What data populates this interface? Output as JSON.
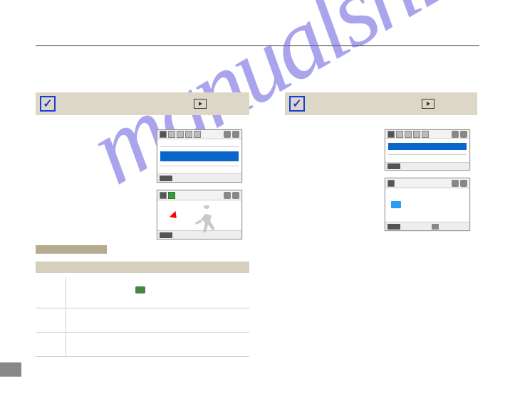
{
  "watermark": "manualshive.com",
  "left": {
    "check": "✓",
    "menu": {
      "items": [
        "",
        "",
        ""
      ]
    }
  },
  "right": {
    "check": "✓",
    "menu": {
      "items": [
        "",
        ""
      ]
    }
  },
  "table": {
    "rows": [
      {
        "chip": true
      },
      {
        "chip": false
      },
      {
        "chip": false
      }
    ]
  }
}
